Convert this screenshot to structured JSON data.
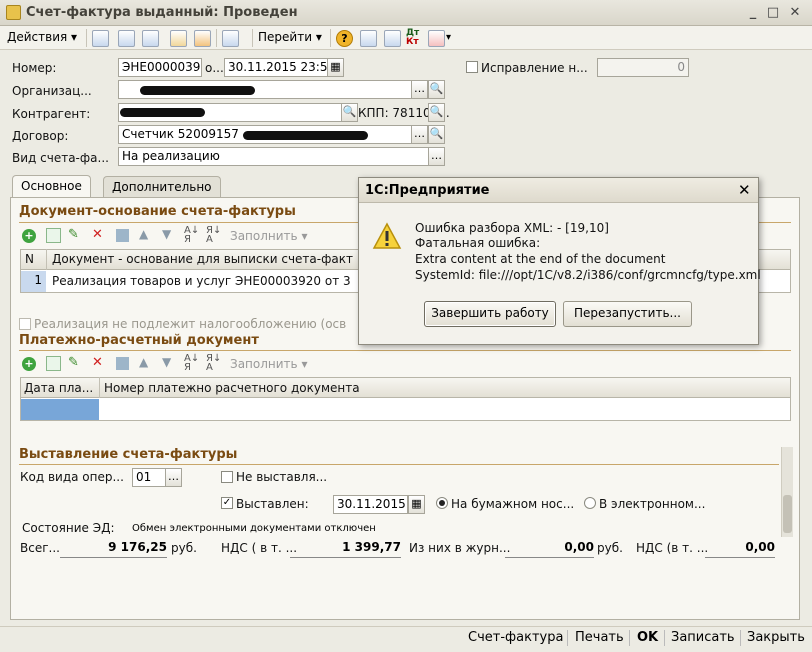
{
  "window": {
    "title": "Счет-фактура выданный: Проведен"
  },
  "toolbar": {
    "actions_label": "Действия",
    "goto_label": "Перейти"
  },
  "form": {
    "number_label": "Номер:",
    "number_value": "ЭНЕ00000392",
    "from_label": "о...",
    "date_value": "30.11.2015 23:59:59",
    "correction_label": "Исправление н...",
    "correction_value": "0",
    "org_label": "Организац...",
    "org_value": "",
    "counterparty_label": "Контрагент:",
    "counterparty_value": "",
    "kpp_value": "КПП: 781101...",
    "contract_label": "Договор:",
    "contract_value": "Счетчик 52009157",
    "kind_label": "Вид счета-фа...",
    "kind_value": "На реализацию"
  },
  "tabs": {
    "main": "Основное",
    "extra": "Дополнительно"
  },
  "basis": {
    "title": "Документ-основание счета-фактуры",
    "fill_label": "Заполнить",
    "col_num": "N",
    "col_doc": "Документ - основание для выписки счета-факт",
    "row_num": "1",
    "row_doc": "Реализация товаров и услуг ЭНЕ00003920 от 3",
    "no_tax_label": "Реализация не подлежит налогообложению (осв"
  },
  "payment": {
    "title": "Платежно-расчетный документ",
    "fill_label": "Заполнить",
    "col_date": "Дата пла...",
    "col_num": "Номер платежно расчетного документа"
  },
  "issue": {
    "title": "Выставление счета-фактуры",
    "op_code_label": "Код вида опер...",
    "op_code_value": "01",
    "not_issued_label": "Не выставля...",
    "issued_label": "Выставлен:",
    "issued_date": "30.11.2015",
    "paper_label": "На бумажном нос...",
    "electronic_label": "В электронном...",
    "ed_state_label": "Состояние ЭД:",
    "ed_state_value": "Обмен электронными документами отключен"
  },
  "totals": {
    "total_label": "Всег...",
    "total_value": "9 176,25",
    "currency": "руб.",
    "vat_label": "НДС ( в т. ...",
    "vat_value": "1 399,77",
    "journal_label": "Из них в журн...",
    "journal_value": "0,00",
    "journal_currency": "руб.",
    "vat2_label": "НДС (в т. ...",
    "vat2_value": "0,00"
  },
  "dialog": {
    "title": "1С:Предприятие",
    "line1": "Ошибка разбора XML:  - [19,10]",
    "line2": "Фатальная ошибка:",
    "line3": "Extra content at the end of the document",
    "line4": "SystemId: file:///opt/1C/v8.2/i386/conf/grcmncfg/type.xml",
    "btn_quit": "Завершить работу",
    "btn_restart": "Перезапустить..."
  },
  "bottom": {
    "invoice": "Счет-фактура",
    "print": "Печать",
    "ok": "OK",
    "save": "Записать",
    "close": "Закрыть"
  }
}
